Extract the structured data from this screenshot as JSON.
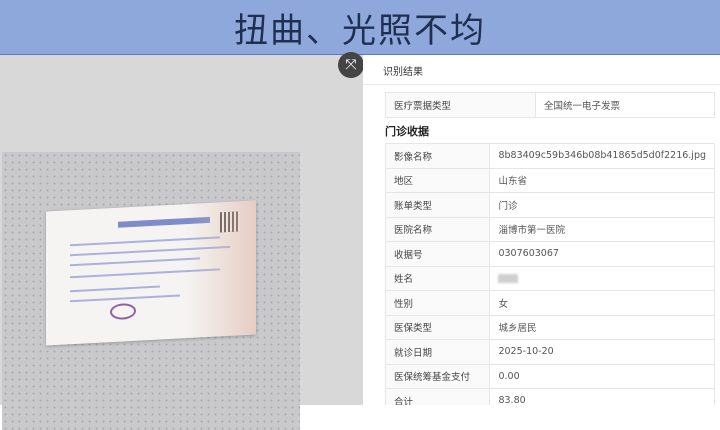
{
  "banner": {
    "title": "扭曲、光照不均"
  },
  "result_panel": {
    "title": "识别结果",
    "ticket_type_row": {
      "label": "医疗票据类型",
      "value": "全国统一电子发票"
    },
    "section_title": "门诊收据",
    "rows": [
      {
        "label": "影像名称",
        "value": "8b83409c59b346b08b41865d5d0f2216.jpg"
      },
      {
        "label": "地区",
        "value": "山东省"
      },
      {
        "label": "账单类型",
        "value": "门诊"
      },
      {
        "label": "医院名称",
        "value": "淄博市第一医院"
      },
      {
        "label": "收据号",
        "value": "0307603067"
      },
      {
        "label": "姓名",
        "value": ""
      },
      {
        "label": "性别",
        "value": "女"
      },
      {
        "label": "医保类型",
        "value": "城乡居民"
      },
      {
        "label": "就诊日期",
        "value": "2025-10-20"
      },
      {
        "label": "医保统筹基金支付",
        "value": "0.00"
      },
      {
        "label": "合计",
        "value": "83.80"
      }
    ]
  },
  "icons": {
    "close": "close-icon"
  }
}
